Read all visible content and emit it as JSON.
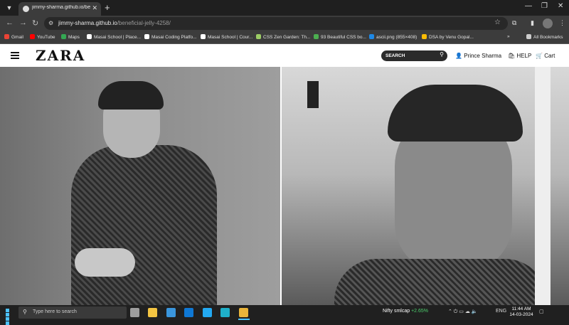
{
  "browser": {
    "tab_title": "jimmy-sharma.github.io/benefi",
    "tab_close": "✕",
    "new_tab": "+",
    "url_domain": "jimmy-sharma.github.io",
    "url_path": "/beneficial-jelly-4258/",
    "bookmarks": [
      {
        "label": "Gmail",
        "color": "#ea4335"
      },
      {
        "label": "YouTube",
        "color": "#ff0000"
      },
      {
        "label": "Maps",
        "color": "#34a853"
      },
      {
        "label": "Masai School | Place...",
        "color": "#ffffff"
      },
      {
        "label": "Masai Coding Platfo...",
        "color": "#ffffff"
      },
      {
        "label": "Masai School | Cour...",
        "color": "#ffffff"
      },
      {
        "label": "CSS Zen Garden: Th...",
        "color": "#9ccc65"
      },
      {
        "label": "93 Beautiful CSS bo...",
        "color": "#4caf50"
      },
      {
        "label": "ascii.png (855×408)",
        "color": "#1e88e5"
      },
      {
        "label": "DSA by Venu Gopal...",
        "color": "#fbbc04"
      }
    ],
    "bookmarks_overflow": "»",
    "all_bookmarks": "All Bookmarks"
  },
  "site": {
    "logo": "ZARA",
    "search_placeholder": "SEARCH",
    "user_name": "Prince Sharma",
    "help": "HELP",
    "cart": "Cart"
  },
  "taskbar": {
    "search_placeholder": "Type here to search",
    "stock_name": "Nifty smlcap",
    "stock_change": "+2.65%",
    "lang": "ENG",
    "time": "11:44 AM",
    "date": "14-03-2024",
    "apps": [
      {
        "name": "task-view",
        "color": "#9e9e9e"
      },
      {
        "name": "file-explorer",
        "color": "#f4c542"
      },
      {
        "name": "store",
        "color": "#3a96dd"
      },
      {
        "name": "mail",
        "color": "#0f78d4"
      },
      {
        "name": "vscode",
        "color": "#23a9f2"
      },
      {
        "name": "edge",
        "color": "#1fb0c9"
      },
      {
        "name": "chrome",
        "color": "#e9b43a"
      }
    ]
  }
}
